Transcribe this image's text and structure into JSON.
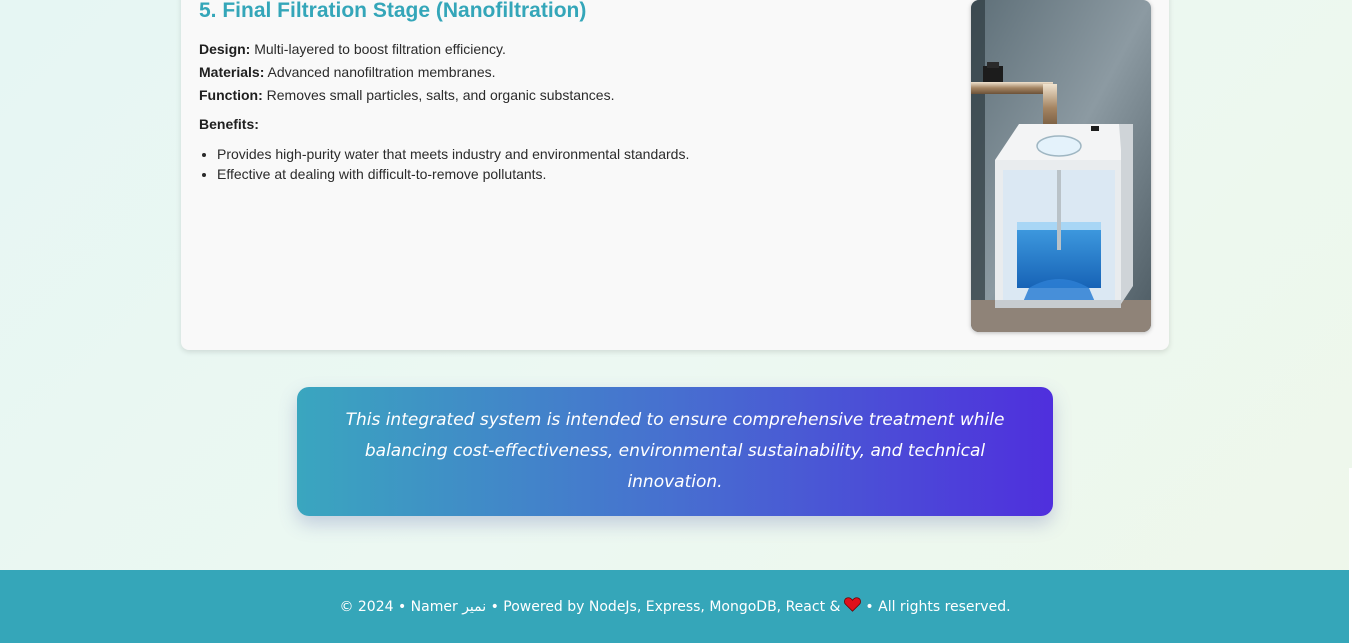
{
  "stage": {
    "title": "5. Final Filtration Stage (Nanofiltration)",
    "design_label": "Design:",
    "design_value": " Multi-layered to boost filtration efficiency.",
    "materials_label": "Materials:",
    "materials_value": " Advanced nanofiltration membranes.",
    "function_label": "Function:",
    "function_value": " Removes small particles, salts, and organic substances.",
    "benefits_heading": "Benefits:",
    "benefits": [
      "Provides high-purity water that meets industry and environmental standards.",
      "Effective at dealing with difficult-to-remove pollutants."
    ],
    "image_icon": "nanofiltration-unit-image"
  },
  "summary": {
    "text": "This integrated system is intended to ensure comprehensive treatment while balancing cost-effectiveness, environmental sustainability, and technical innovation."
  },
  "footer": {
    "text_before": "© 2024 • Namer نمير • Powered by NodeJs, Express, MongoDB, React &",
    "heart_icon": "heart-icon",
    "text_after": "• All rights reserved."
  },
  "colors": {
    "title": "#34a6b9",
    "footer_bg": "#35a6b9",
    "gradient_start": "#3aa6bf",
    "gradient_end": "#4f2fdd",
    "heart": "#e0101b"
  }
}
